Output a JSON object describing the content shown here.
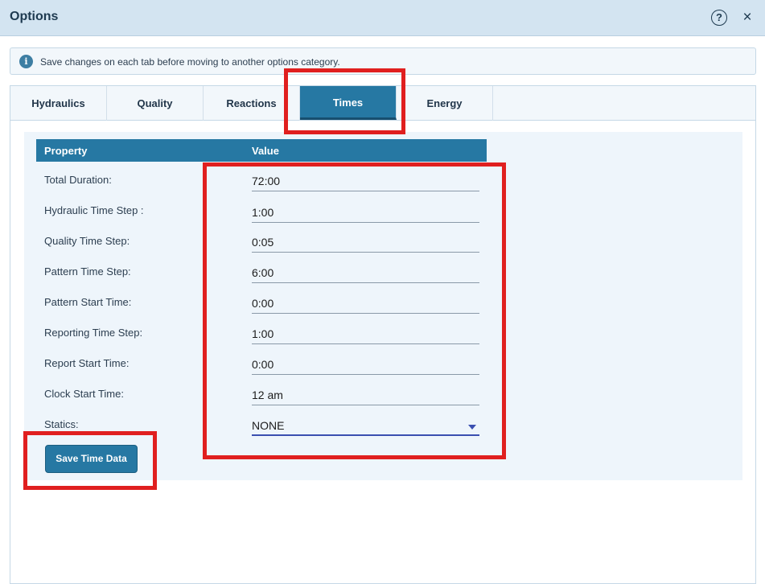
{
  "window": {
    "title": "Options",
    "help_glyph": "?",
    "close_glyph": "×"
  },
  "info": {
    "icon_glyph": "i",
    "message": "Save changes on each tab before moving to another options category."
  },
  "tabs": [
    {
      "label": "Hydraulics",
      "active": false
    },
    {
      "label": "Quality",
      "active": false
    },
    {
      "label": "Reactions",
      "active": false
    },
    {
      "label": "Times",
      "active": true
    },
    {
      "label": "Energy",
      "active": false
    }
  ],
  "table": {
    "headers": {
      "property": "Property",
      "value": "Value"
    },
    "rows": [
      {
        "label": "Total Duration:",
        "value": "72:00"
      },
      {
        "label": "Hydraulic Time Step :",
        "value": "1:00"
      },
      {
        "label": "Quality Time Step:",
        "value": "0:05"
      },
      {
        "label": "Pattern Time Step:",
        "value": "6:00"
      },
      {
        "label": "Pattern Start Time:",
        "value": "0:00"
      },
      {
        "label": "Reporting Time Step:",
        "value": "1:00"
      },
      {
        "label": "Report Start Time:",
        "value": "0:00"
      },
      {
        "label": "Clock Start Time:",
        "value": "12 am"
      },
      {
        "label": "Statics:",
        "value": "NONE"
      }
    ]
  },
  "save_button": {
    "label": "Save Time Data"
  },
  "colors": {
    "accent": "#2678a3",
    "highlight": "#e01f1f",
    "titlebar": "#d3e4f1"
  }
}
